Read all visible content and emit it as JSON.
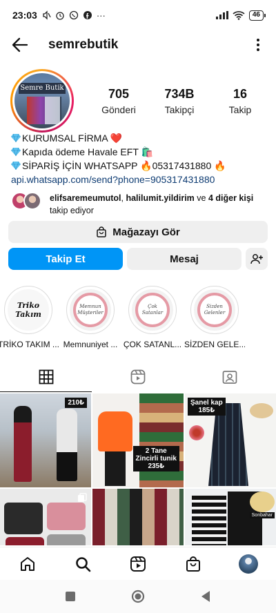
{
  "status_bar": {
    "time": "23:03",
    "battery": "46",
    "more": "···"
  },
  "header": {
    "username": "semrebutik"
  },
  "profile": {
    "avatar_sign": "Semre Butik",
    "stats": [
      {
        "num": "705",
        "label": "Gönderi"
      },
      {
        "num": "734B",
        "label": "Takipçi"
      },
      {
        "num": "16",
        "label": "Takip"
      }
    ],
    "bio_lines": [
      "KURUMSAL FİRMA ❤️",
      "Kapıda ödeme Havale EFT 🛍️",
      "SİPARİŞ İÇİN WHATSAPP 🔥05317431880 🔥"
    ],
    "link": "api.whatsapp.com/send?phone=905317431880",
    "followed_by": {
      "user1": "elifsaremeumutol",
      "sep": ", ",
      "user2": "halilumit.yildirim",
      "mid": " ve ",
      "others": "4 diğer kişi",
      "end": " takip ediyor"
    }
  },
  "buttons": {
    "store": "Mağazayı Gör",
    "follow": "Takip Et",
    "message": "Mesaj"
  },
  "highlights": [
    {
      "cover": "Triko Takım",
      "label": "TRİKO TAKIM ..."
    },
    {
      "cover": "Memnun Müşteriler",
      "label": "Memnuniyet ..."
    },
    {
      "cover": "Çok Satanlar",
      "label": "ÇOK SATANL..."
    },
    {
      "cover": "Sizden Gelenler",
      "label": "SİZDEN GELE..."
    }
  ],
  "posts": {
    "p1_price": "210₺",
    "p2_price_line1": "2 Tane",
    "p2_price_line2": "Zincirli tunik",
    "p2_price_line3": "235₺",
    "p3_label": "Şanel kap",
    "p3_price": "185₺",
    "p6_tag": "Sonbahar"
  },
  "colors": {
    "primary_blue": "#0095f6",
    "button_gray": "#efefef",
    "link_blue": "#0d3b72"
  }
}
